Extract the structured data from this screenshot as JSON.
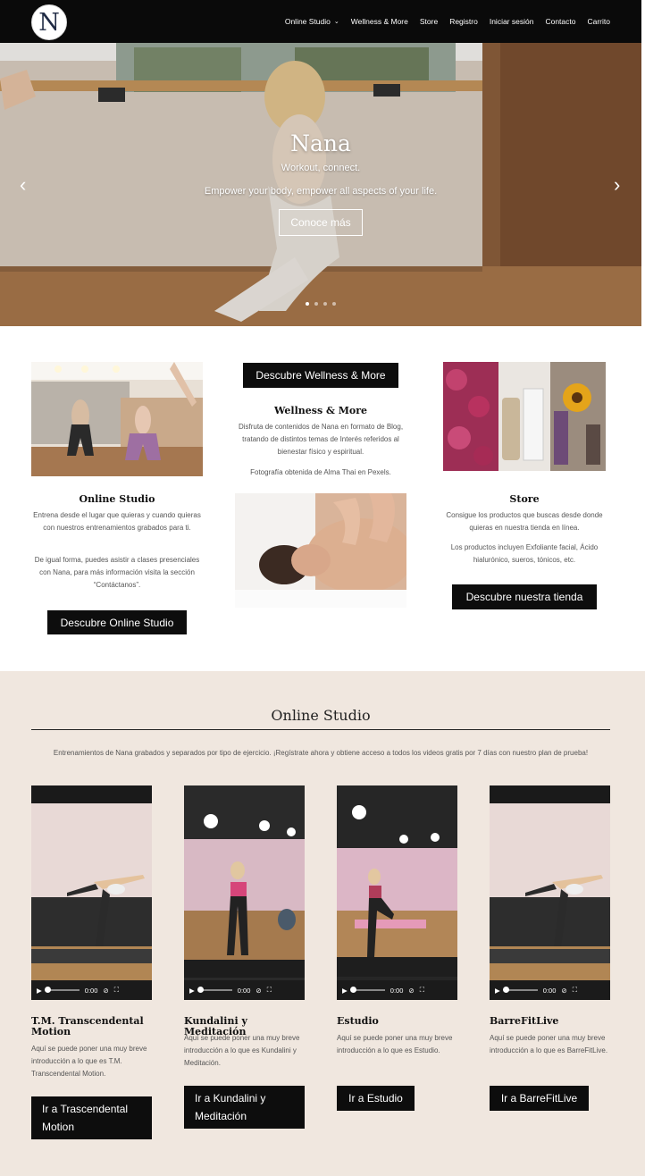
{
  "header": {
    "logo_letter": "N",
    "nav": [
      {
        "label": "Online Studio",
        "dropdown": true
      },
      {
        "label": "Wellness & More"
      },
      {
        "label": "Store"
      },
      {
        "label": "Registro"
      },
      {
        "label": "Iniciar sesión"
      },
      {
        "label": "Contacto"
      },
      {
        "label": "Carrito"
      }
    ]
  },
  "hero": {
    "title": "Nana",
    "subtitle": "Workout, connect.",
    "description": "Empower your body, empower all aspects of your life.",
    "button": "Conoce más",
    "prev_icon": "‹",
    "next_icon": "›",
    "slide_count": 4,
    "active_slide": 1
  },
  "features": {
    "online": {
      "title": "Online Studio",
      "text1": "Entrena desde el lugar que quieras y cuando quieras con nuestros entrenamientos grabados para ti.",
      "text2": "De igual forma, puedes asistir a clases presenciales con Nana, para más información visita la sección “Contáctanos”.",
      "button": "Descubre Online Studio"
    },
    "wellness": {
      "button": "Descubre Wellness & More",
      "title": "Wellness & More",
      "text1": "Disfruta de contenidos de Nana en formato de Blog, tratando de distintos temas de Interés referidos al bienestar físico y espiritual.",
      "text2": "Fotografía obtenida de Alma Thai en Pexels."
    },
    "store": {
      "title": "Store",
      "text1": "Consigue los productos que buscas desde donde quieras en nuestra tienda en línea.",
      "text2": "Los productos incluyen Exfoliante facial, Ácido hialurónico, sueros, tónicos, etc.",
      "button": "Descubre nuestra tienda"
    }
  },
  "studio": {
    "title": "Online Studio",
    "intro": "Entrenamientos de Nana grabados y separados por tipo de ejercicio. ¡Regístrate ahora y obtiene acceso a todos los videos gratis por 7 días con nuestro plan de prueba!",
    "time": "0:00",
    "cards": [
      {
        "title": "T.M. Transcendental Motion",
        "text": "Aquí se puede poner una muy breve introducción a lo que es T.M. Transcendental Motion.",
        "button": "Ir a Trascendental Motion"
      },
      {
        "title": "Kundalini y Meditación",
        "text": "Aquí se puede poner una muy breve introducción a lo que es Kundalini y Meditación.",
        "button": "Ir a Kundalini y Meditación"
      },
      {
        "title": "Estudio",
        "text": "Aquí se puede poner una muy breve introducción a lo que es Estudio.",
        "button": "Ir a Estudio"
      },
      {
        "title": "BarreFitLive",
        "text": "Aquí se puede poner una muy breve introducción a lo que es BarreFitLive.",
        "button": "Ir a BarreFitLive"
      }
    ]
  }
}
